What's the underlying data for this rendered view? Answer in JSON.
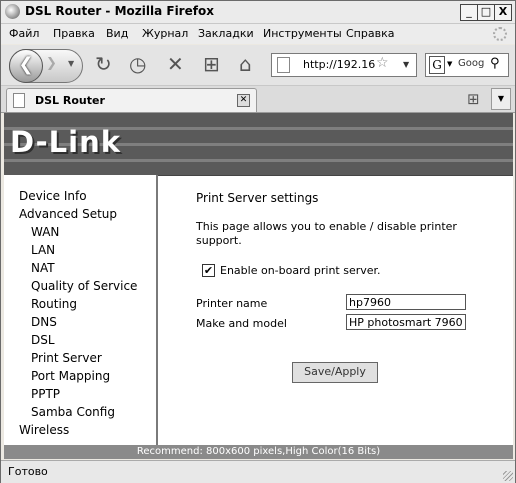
{
  "window": {
    "title": "DSL Router - Mozilla Firefox",
    "min": "_",
    "max": "□",
    "close": "X"
  },
  "menu": {
    "file": "Файл",
    "edit": "Правка",
    "view": "Вид",
    "journal": "Журнал",
    "bookmarks": "Закладки",
    "tools": "Инструменты",
    "help": "Справка"
  },
  "toolbar": {
    "url": "http://192.16",
    "search_text": "Goog"
  },
  "tab": {
    "title": "DSL Router"
  },
  "brand": {
    "logo": "D-Link"
  },
  "sidebar": {
    "items": [
      {
        "label": "Device Info"
      },
      {
        "label": "Advanced Setup"
      },
      {
        "label": "WAN"
      },
      {
        "label": "LAN"
      },
      {
        "label": "NAT"
      },
      {
        "label": "Quality of Service"
      },
      {
        "label": "Routing"
      },
      {
        "label": "DNS"
      },
      {
        "label": "DSL"
      },
      {
        "label": "Print Server"
      },
      {
        "label": "Port Mapping"
      },
      {
        "label": "PPTP"
      },
      {
        "label": "Samba Config"
      },
      {
        "label": "Wireless"
      }
    ]
  },
  "main": {
    "heading": "Print Server settings",
    "description": "This page allows you to enable / disable printer support.",
    "enable_label": "Enable on-board print server.",
    "enable_checked": true,
    "printer_name_label": "Printer name",
    "printer_name_value": "hp7960",
    "make_model_label": "Make and model",
    "make_model_value": "HP photosmart 7960",
    "save_label": "Save/Apply"
  },
  "footer": {
    "text": "Recommend: 800x600 pixels,High Color(16 Bits)"
  },
  "status": {
    "text": "Готово"
  }
}
